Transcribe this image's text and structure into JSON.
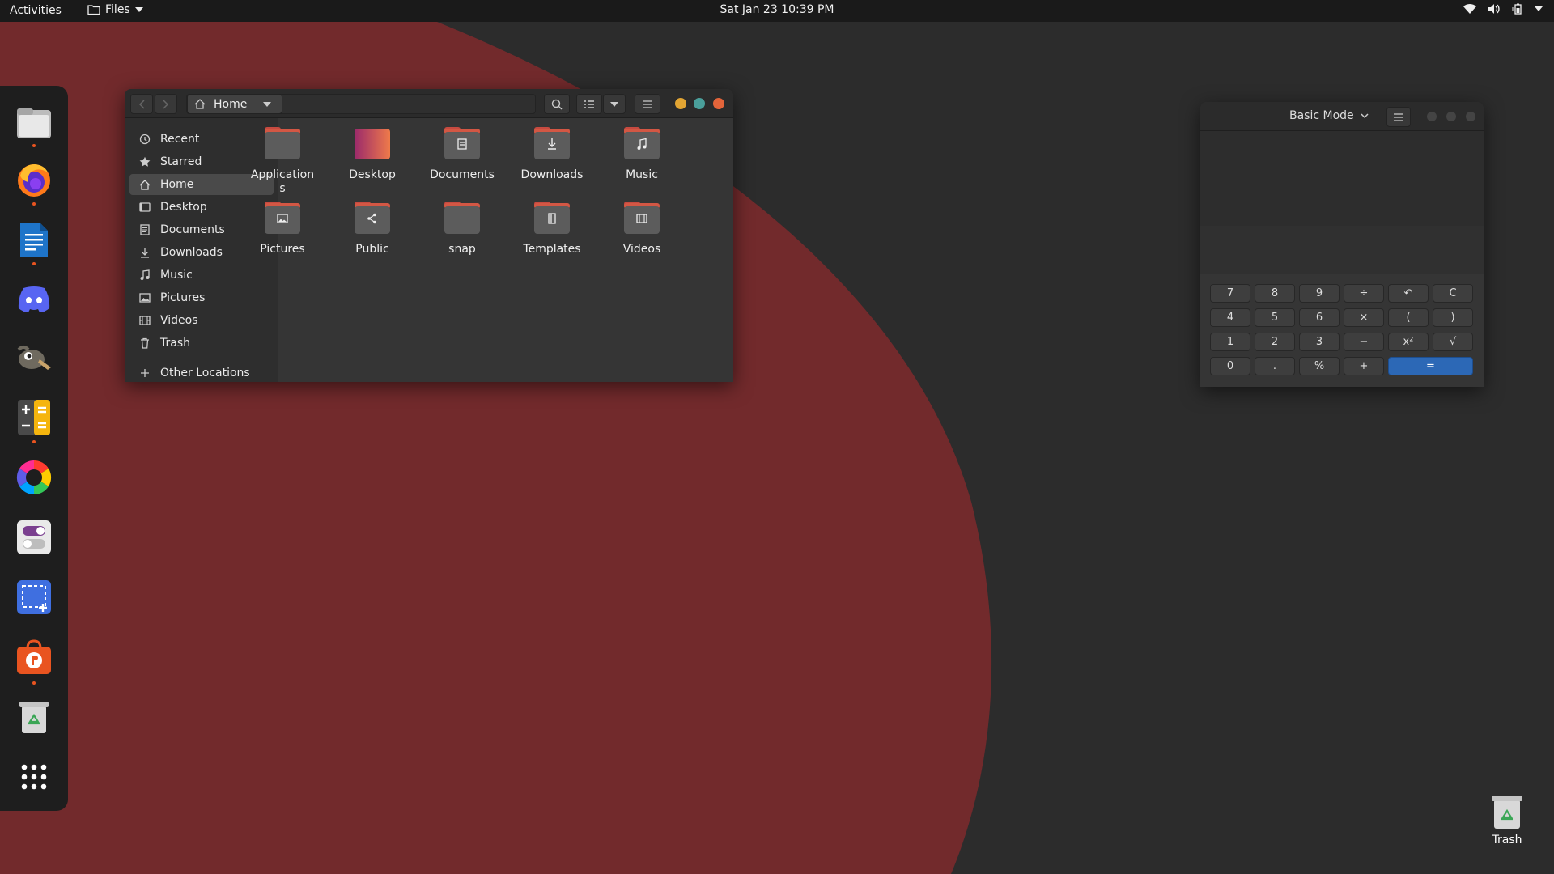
{
  "topbar": {
    "activities": "Activities",
    "app_menu": "Files",
    "clock": "Sat Jan 23  10:39 PM"
  },
  "dock": {
    "items": [
      {
        "name": "files-app",
        "running": true
      },
      {
        "name": "firefox",
        "running": true
      },
      {
        "name": "libreoffice-writer",
        "running": true
      },
      {
        "name": "discord",
        "running": false
      },
      {
        "name": "gimp",
        "running": false
      },
      {
        "name": "calculator",
        "running": true
      },
      {
        "name": "color-picker",
        "running": false
      },
      {
        "name": "settings-toggle",
        "running": false
      },
      {
        "name": "screenshot",
        "running": false
      },
      {
        "name": "software-store",
        "running": true
      },
      {
        "name": "trash",
        "running": false
      },
      {
        "name": "show-applications",
        "running": false
      }
    ]
  },
  "files": {
    "path": "Home",
    "sidebar": [
      {
        "label": "Recent",
        "icon": "clock-icon"
      },
      {
        "label": "Starred",
        "icon": "star-icon"
      },
      {
        "label": "Home",
        "icon": "home-icon",
        "active": true
      },
      {
        "label": "Desktop",
        "icon": "desktop-icon"
      },
      {
        "label": "Documents",
        "icon": "document-icon"
      },
      {
        "label": "Downloads",
        "icon": "download-icon"
      },
      {
        "label": "Music",
        "icon": "music-icon"
      },
      {
        "label": "Pictures",
        "icon": "picture-icon"
      },
      {
        "label": "Videos",
        "icon": "video-icon"
      },
      {
        "label": "Trash",
        "icon": "trash-icon"
      }
    ],
    "other_locations": "Other Locations",
    "folders": [
      {
        "label": "Application\ns",
        "emblem": "none"
      },
      {
        "label": "Desktop",
        "emblem": "desktop"
      },
      {
        "label": "Documents",
        "emblem": "document"
      },
      {
        "label": "Downloads",
        "emblem": "download"
      },
      {
        "label": "Music",
        "emblem": "music"
      },
      {
        "label": "Pictures",
        "emblem": "picture"
      },
      {
        "label": "Public",
        "emblem": "share"
      },
      {
        "label": "snap",
        "emblem": "none"
      },
      {
        "label": "Templates",
        "emblem": "template"
      },
      {
        "label": "Videos",
        "emblem": "video"
      }
    ]
  },
  "calculator": {
    "mode": "Basic Mode",
    "keys": [
      "7",
      "8",
      "9",
      "÷",
      "↶",
      "C",
      "4",
      "5",
      "6",
      "×",
      "(",
      ")",
      "1",
      "2",
      "3",
      "−",
      "x²",
      "√",
      "0",
      ".",
      "%",
      "+",
      "="
    ]
  },
  "desktop": {
    "trash_label": "Trash"
  },
  "colors": {
    "wallpaper_red": "#722a2c",
    "wallpaper_gray": "#2c2c2c",
    "accent_orange": "#e95420",
    "calc_equals_blue": "#2c68b6",
    "win_minimize": "#e2a533",
    "win_maximize": "#4a9f9b",
    "win_close": "#e3643a"
  }
}
